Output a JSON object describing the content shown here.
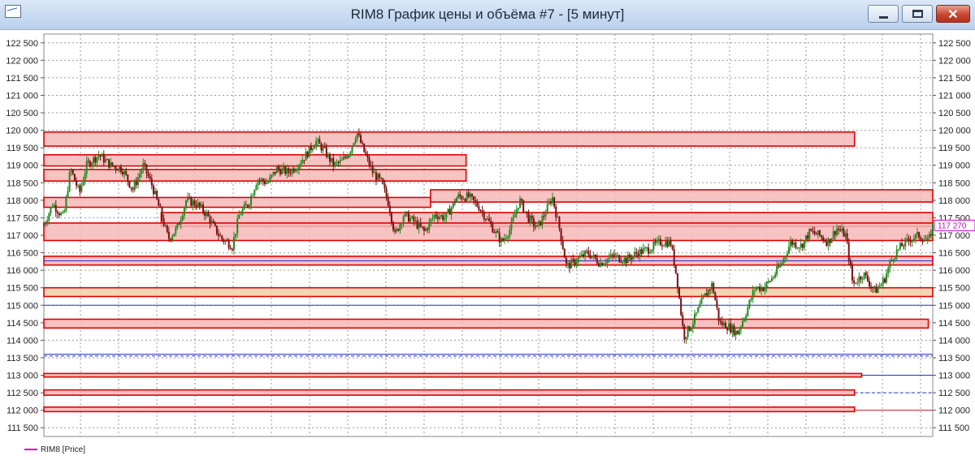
{
  "window": {
    "title": "RIM8 График цены и объёма #7 - [5 минут]",
    "min_glyph": "",
    "close_glyph": "✕"
  },
  "legend": {
    "label": "RIM8 [Price]",
    "color": "#cc00cc"
  },
  "chart_data": {
    "type": "candlestick",
    "title": "RIM8 График цены и объёма #7 - [5 минут]",
    "timeframe": "5 минут",
    "ylim": [
      111250,
      122750
    ],
    "y_ticks": [
      111500,
      112000,
      112500,
      113000,
      113500,
      114000,
      114500,
      115000,
      115500,
      116000,
      116500,
      117000,
      117500,
      118000,
      118500,
      119000,
      119500,
      120000,
      120500,
      121000,
      121500,
      122000,
      122500
    ],
    "y_tick_labels": [
      "111 500",
      "112 000",
      "112 500",
      "113 000",
      "113 500",
      "114 000",
      "114 500",
      "115 000",
      "115 500",
      "116 000",
      "116 500",
      "117 000",
      "117 500",
      "118 000",
      "118 500",
      "119 000",
      "119 500",
      "120 000",
      "120 500",
      "121 000",
      "121 500",
      "122 000",
      "122 500"
    ],
    "grid": true,
    "last_price": 117270,
    "last_price_label": "117 270",
    "up_color": "#1f8a1f",
    "down_color": "#7a1010",
    "zone_fill": "#f6b8b8",
    "zone_border": "#e00000",
    "level_line_color": "#2233cc",
    "price_path": [
      [
        0.0,
        117300
      ],
      [
        0.01,
        117900
      ],
      [
        0.022,
        117500
      ],
      [
        0.03,
        118900
      ],
      [
        0.04,
        118200
      ],
      [
        0.048,
        119000
      ],
      [
        0.062,
        119300
      ],
      [
        0.075,
        119000
      ],
      [
        0.088,
        118900
      ],
      [
        0.1,
        118300
      ],
      [
        0.112,
        119000
      ],
      [
        0.122,
        118400
      ],
      [
        0.132,
        117600
      ],
      [
        0.14,
        116900
      ],
      [
        0.15,
        117200
      ],
      [
        0.16,
        118000
      ],
      [
        0.172,
        117900
      ],
      [
        0.183,
        117600
      ],
      [
        0.192,
        117200
      ],
      [
        0.2,
        116900
      ],
      [
        0.212,
        116700
      ],
      [
        0.22,
        117600
      ],
      [
        0.23,
        117900
      ],
      [
        0.24,
        118600
      ],
      [
        0.252,
        118500
      ],
      [
        0.262,
        118900
      ],
      [
        0.275,
        118800
      ],
      [
        0.285,
        119000
      ],
      [
        0.295,
        119300
      ],
      [
        0.306,
        119700
      ],
      [
        0.316,
        119400
      ],
      [
        0.326,
        119000
      ],
      [
        0.335,
        119100
      ],
      [
        0.344,
        119400
      ],
      [
        0.352,
        119950
      ],
      [
        0.36,
        119400
      ],
      [
        0.37,
        118800
      ],
      [
        0.38,
        118500
      ],
      [
        0.388,
        117900
      ],
      [
        0.395,
        117000
      ],
      [
        0.405,
        117600
      ],
      [
        0.416,
        117400
      ],
      [
        0.428,
        117100
      ],
      [
        0.44,
        117600
      ],
      [
        0.452,
        117500
      ],
      [
        0.465,
        118100
      ],
      [
        0.478,
        118100
      ],
      [
        0.49,
        117800
      ],
      [
        0.505,
        117200
      ],
      [
        0.515,
        116800
      ],
      [
        0.525,
        117200
      ],
      [
        0.535,
        118000
      ],
      [
        0.545,
        117500
      ],
      [
        0.555,
        117200
      ],
      [
        0.565,
        117700
      ],
      [
        0.572,
        118100
      ],
      [
        0.58,
        117200
      ],
      [
        0.588,
        116100
      ],
      [
        0.6,
        116300
      ],
      [
        0.612,
        116500
      ],
      [
        0.626,
        116200
      ],
      [
        0.64,
        116400
      ],
      [
        0.655,
        116300
      ],
      [
        0.668,
        116500
      ],
      [
        0.68,
        116600
      ],
      [
        0.693,
        116800
      ],
      [
        0.705,
        116800
      ],
      [
        0.712,
        115800
      ],
      [
        0.72,
        114100
      ],
      [
        0.73,
        114500
      ],
      [
        0.742,
        115200
      ],
      [
        0.752,
        115600
      ],
      [
        0.76,
        114500
      ],
      [
        0.77,
        114400
      ],
      [
        0.78,
        114200
      ],
      [
        0.79,
        114800
      ],
      [
        0.8,
        115500
      ],
      [
        0.81,
        115500
      ],
      [
        0.82,
        115800
      ],
      [
        0.83,
        116200
      ],
      [
        0.84,
        116800
      ],
      [
        0.852,
        116700
      ],
      [
        0.862,
        117100
      ],
      [
        0.872,
        117000
      ],
      [
        0.882,
        116800
      ],
      [
        0.892,
        117200
      ],
      [
        0.902,
        117000
      ],
      [
        0.91,
        115600
      ],
      [
        0.922,
        115900
      ],
      [
        0.935,
        115400
      ],
      [
        0.945,
        115700
      ],
      [
        0.955,
        116400
      ],
      [
        0.965,
        116700
      ],
      [
        0.975,
        116900
      ],
      [
        0.985,
        117000
      ],
      [
        0.995,
        116800
      ],
      [
        1.0,
        117270
      ]
    ],
    "zones": [
      {
        "low": 119550,
        "high": 119950,
        "x_end": 0.912
      },
      {
        "low": 118980,
        "high": 119300,
        "x_end": 0.475
      },
      {
        "low": 118550,
        "high": 118880,
        "x_end": 0.475
      },
      {
        "low": 117800,
        "high": 118080,
        "x_end": 0.435
      },
      {
        "low": 117950,
        "high": 118300,
        "x_start": 0.435,
        "x_end": 1.0
      },
      {
        "low": 117250,
        "high": 117650,
        "x_start": 0.132,
        "x_end": 1.0
      },
      {
        "low": 116850,
        "high": 117350,
        "x_end": 1.0
      },
      {
        "low": 116150,
        "high": 116400,
        "x_end": 1.0
      },
      {
        "low": 115250,
        "high": 115500,
        "x_end": 1.0,
        "shade": "tan"
      },
      {
        "low": 114350,
        "high": 114600,
        "x_end": 0.995
      },
      {
        "low": 112950,
        "high": 113050,
        "x_end": 0.92
      },
      {
        "low": 112430,
        "high": 112580,
        "x_end": 0.912
      },
      {
        "low": 111960,
        "high": 112090,
        "x_end": 0.912
      }
    ],
    "lines": [
      {
        "price": 116270,
        "style": "solid"
      },
      {
        "price": 115000,
        "style": "solid"
      },
      {
        "price": 113600,
        "style": "solid"
      },
      {
        "price": 113550,
        "style": "dashed"
      },
      {
        "price": 113000,
        "style": "solid",
        "x_start": 0.92
      },
      {
        "price": 112500,
        "style": "dashed",
        "x_start": 0.912
      },
      {
        "price": 112000,
        "style": "solid",
        "x_start": 0.912,
        "color": "#cc2222"
      }
    ]
  }
}
